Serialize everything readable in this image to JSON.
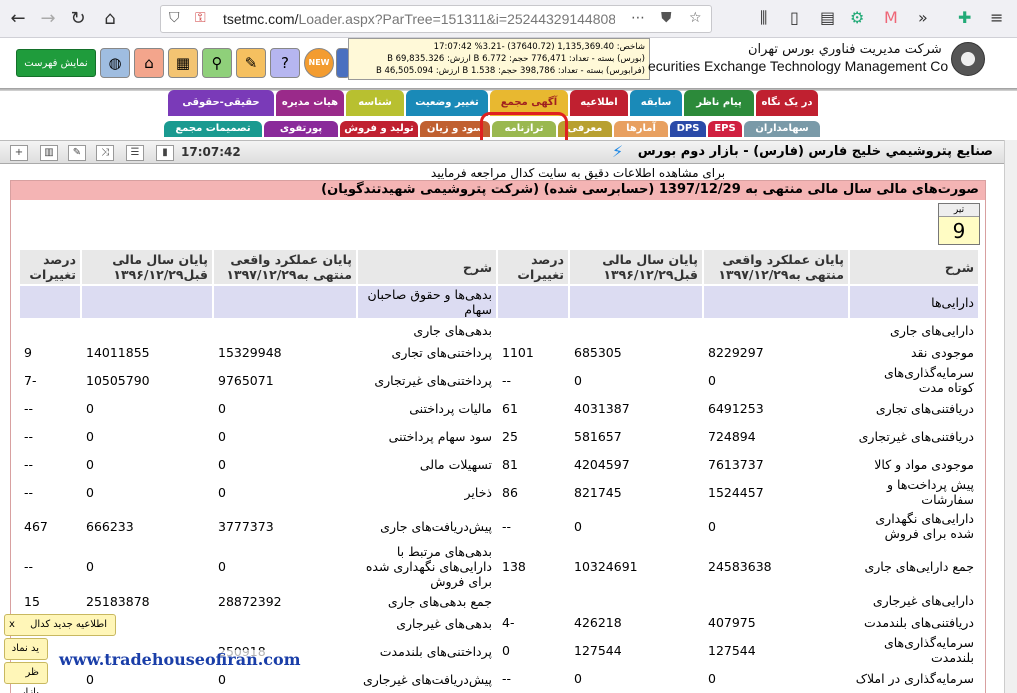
{
  "browser": {
    "url_main": "tsetmc.com/",
    "url_path": "Loader.aspx?ParTree=151311&i=25244329144808274"
  },
  "header": {
    "show_menu": "نمایش فهرست",
    "new_badge": "NEW",
    "company_fa": "شركت مديريت فناوري بورس تهران",
    "company_en": "ecurities Exchange Technology Management Co",
    "ticker_line1": "شاخص: 1,135,369.40 (37640.72) -3.21% 17:07:42",
    "ticker_line2": "(بورس) بسته - تعداد: 776,471 حجم: 6.772 B ارزش: 69,835.326 B",
    "ticker_line3": "(فرابورس) بسته - تعداد: 398,786 حجم: 1.538 B ارزش: 46,505.094 B"
  },
  "tabs_top": [
    "در یک نگاه",
    "پیام ناظر",
    "سابقه",
    "اطلاعیه",
    "آگهی مجمع",
    "تغییر وضعیت",
    "شناسه",
    "هیات مدیره",
    "حقیقی-حقوقی"
  ],
  "tabs_bottom": [
    "سهامداران",
    "EPS",
    "DPS",
    "آمارها",
    "معرفی",
    "ترازنامه",
    "سود و زیان",
    "تولید و فروش",
    "پورتفوی",
    "تصمیمات مجمع"
  ],
  "toolbar": {
    "time": "17:07:42",
    "title": "صنايع پتروشيمي خليج فارس (فارس) - بازار دوم بورس"
  },
  "notice": "برای مشاهده اطلاعات دقیق به سایت کدال مراجعه فرمایید",
  "report_title": "صورت‌های مالی سال مالی منتهی به 1397/12/29 (حسابرسی شده) (شرکت پتروشیمی شهیدتندگویان)",
  "date_box": {
    "month": "تیر",
    "day": "9"
  },
  "columns": {
    "desc": "شرح",
    "actual": "پایان عملکرد واقعی منتهی به۱۳۹۷/۱۲/۲۹",
    "prev": "پایان سال مالی قبل۱۳۹۶/۱۲/۲۹",
    "change": "درصد تغییرات"
  },
  "right_rows": [
    {
      "label": "دارایی‌ها",
      "a": "",
      "b": "",
      "c": "",
      "type": "sect"
    },
    {
      "label": "دارایی‌های جاری",
      "a": "",
      "b": "",
      "c": "",
      "type": "r1"
    },
    {
      "label": "موجودی نقد",
      "a": "8229297",
      "b": "685305",
      "c": "1101",
      "type": "r1"
    },
    {
      "label": "سرمایه‌گذاری‌های کوتاه مدت",
      "a": "0",
      "b": "0",
      "c": "--",
      "type": "r2"
    },
    {
      "label": "دریافتنی‌های تجاری",
      "a": "6491253",
      "b": "4031387",
      "c": "61",
      "type": "r1"
    },
    {
      "label": "دریافتنی‌های غیرتجاری",
      "a": "724894",
      "b": "581657",
      "c": "25",
      "type": "r2"
    },
    {
      "label": "موجودی مواد و کالا",
      "a": "7613737",
      "b": "4204597",
      "c": "81",
      "type": "r1"
    },
    {
      "label": "پیش پرداخت‌ها و سفارشات",
      "a": "1524457",
      "b": "821745",
      "c": "86",
      "type": "r2"
    },
    {
      "label": "دارایی‌های نگهداری شده برای فروش",
      "a": "0",
      "b": "0",
      "c": "--",
      "type": "r2"
    },
    {
      "label": "جمع دارایی‌های جاری",
      "a": "24583638",
      "b": "10324691",
      "c": "138",
      "type": "r3"
    },
    {
      "label": "دارایی‌های غیرجاری",
      "a": "",
      "b": "",
      "c": "",
      "type": "r1"
    },
    {
      "label": "دریافتنی‌های بلندمدت",
      "a": "407975",
      "b": "426218",
      "c": "4-",
      "type": "r1"
    },
    {
      "label": "سرمایه‌گذاری‌های بلندمدت",
      "a": "127544",
      "b": "127544",
      "c": "0",
      "type": "r2"
    },
    {
      "label": "سرمایه‌گذاری در املاک",
      "a": "0",
      "b": "0",
      "c": "--",
      "type": "r1"
    }
  ],
  "left_rows": [
    {
      "label": "بدهی‌ها و حقوق صاحبان سهام",
      "a": "",
      "b": "",
      "c": "",
      "type": "sect"
    },
    {
      "label": "بدهی‌های جاری",
      "a": "",
      "b": "",
      "c": "",
      "type": "r1"
    },
    {
      "label": "پرداختنی‌های تجاری",
      "a": "15329948",
      "b": "14011855",
      "c": "9",
      "type": "r1"
    },
    {
      "label": "پرداختنی‌های غیرتجاری",
      "a": "9765071",
      "b": "10505790",
      "c": "7-",
      "type": "r2"
    },
    {
      "label": "مالیات پرداختنی",
      "a": "0",
      "b": "0",
      "c": "--",
      "type": "r1"
    },
    {
      "label": "سود سهام پرداختنی",
      "a": "0",
      "b": "0",
      "c": "--",
      "type": "r2"
    },
    {
      "label": "تسهیلات مالی",
      "a": "0",
      "b": "0",
      "c": "--",
      "type": "r1"
    },
    {
      "label": "ذخایر",
      "a": "0",
      "b": "0",
      "c": "--",
      "type": "r2"
    },
    {
      "label": "پیش‌دریافت‌های جاری",
      "a": "3777373",
      "b": "666233",
      "c": "467",
      "type": "r2"
    },
    {
      "label": "بدهی‌های مرتبط با دارایی‌های نگهداری شده برای فروش",
      "a": "0",
      "b": "0",
      "c": "--",
      "type": "r3"
    },
    {
      "label": "جمع بدهی‌های جاری",
      "a": "28872392",
      "b": "25183878",
      "c": "15",
      "type": "r1"
    },
    {
      "label": "بدهی‌های غیرجاری",
      "a": "",
      "b": "",
      "c": "",
      "type": "r1"
    },
    {
      "label": "پرداختنی‌های بلندمدت",
      "a": "250918",
      "b": "",
      "c": "",
      "type": "r2"
    },
    {
      "label": "پیش‌دریافت‌های غیرجاری",
      "a": "0",
      "b": "0",
      "c": "--",
      "type": "r1"
    }
  ],
  "popups": [
    "اطلاعیه جدید کدال",
    "ید نماد",
    "ظر بازار"
  ],
  "watermark": "www.tradehouseofiran.com"
}
